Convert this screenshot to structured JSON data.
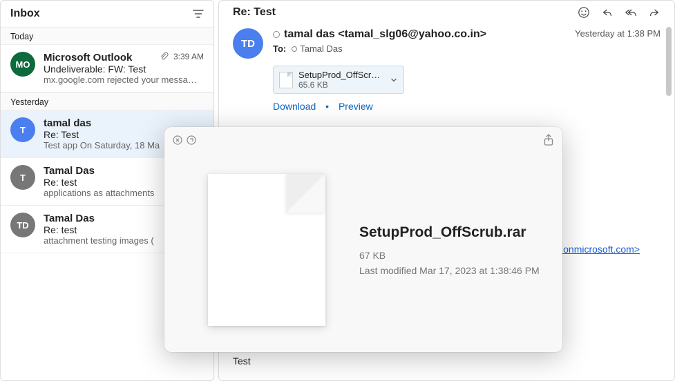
{
  "sidebar": {
    "title": "Inbox",
    "groups": [
      {
        "label": "Today",
        "items": [
          {
            "avatar_txt": "MO",
            "avatar_color": "#0d6a3c",
            "sender": "Microsoft Outlook",
            "has_attachment": true,
            "time": "3:39 AM",
            "subject": "Undeliverable: FW: Test",
            "preview": "mx.google.com rejected your messa…",
            "selected": false
          }
        ]
      },
      {
        "label": "Yesterday",
        "items": [
          {
            "avatar_txt": "T",
            "avatar_color": "#4b7ff0",
            "sender": "tamal das",
            "subject": "Re: Test",
            "preview": "Test app On Saturday, 18 Ma",
            "selected": true
          },
          {
            "avatar_txt": "T",
            "avatar_color": "#777",
            "sender": "Tamal Das",
            "subject": "Re: test",
            "preview": "applications as attachments",
            "selected": false
          },
          {
            "avatar_txt": "TD",
            "avatar_color": "#777",
            "sender": "Tamal Das",
            "subject": "Re: test",
            "preview": "attachment testing images (",
            "selected": false
          }
        ]
      }
    ]
  },
  "reader": {
    "subject": "Re: Test",
    "timestamp": "Yesterday at 1:38 PM",
    "avatar_txt": "TD",
    "avatar_color": "#4b7ff0",
    "from": "tamal das <tamal_slg06@yahoo.co.in>",
    "to_label": "To:",
    "to_value": "Tamal Das",
    "attachment": {
      "name": "SetupProd_OffScrub…",
      "size": "65.6 KB"
    },
    "download_label": "Download",
    "preview_label": "Preview",
    "body": "Test",
    "link_fragment": ".onmicrosoft.com>"
  },
  "quicklook": {
    "filename": "SetupProd_OffScrub.rar",
    "size": "67 KB",
    "modified": "Last modified Mar 17, 2023 at 1:38:46 PM"
  }
}
